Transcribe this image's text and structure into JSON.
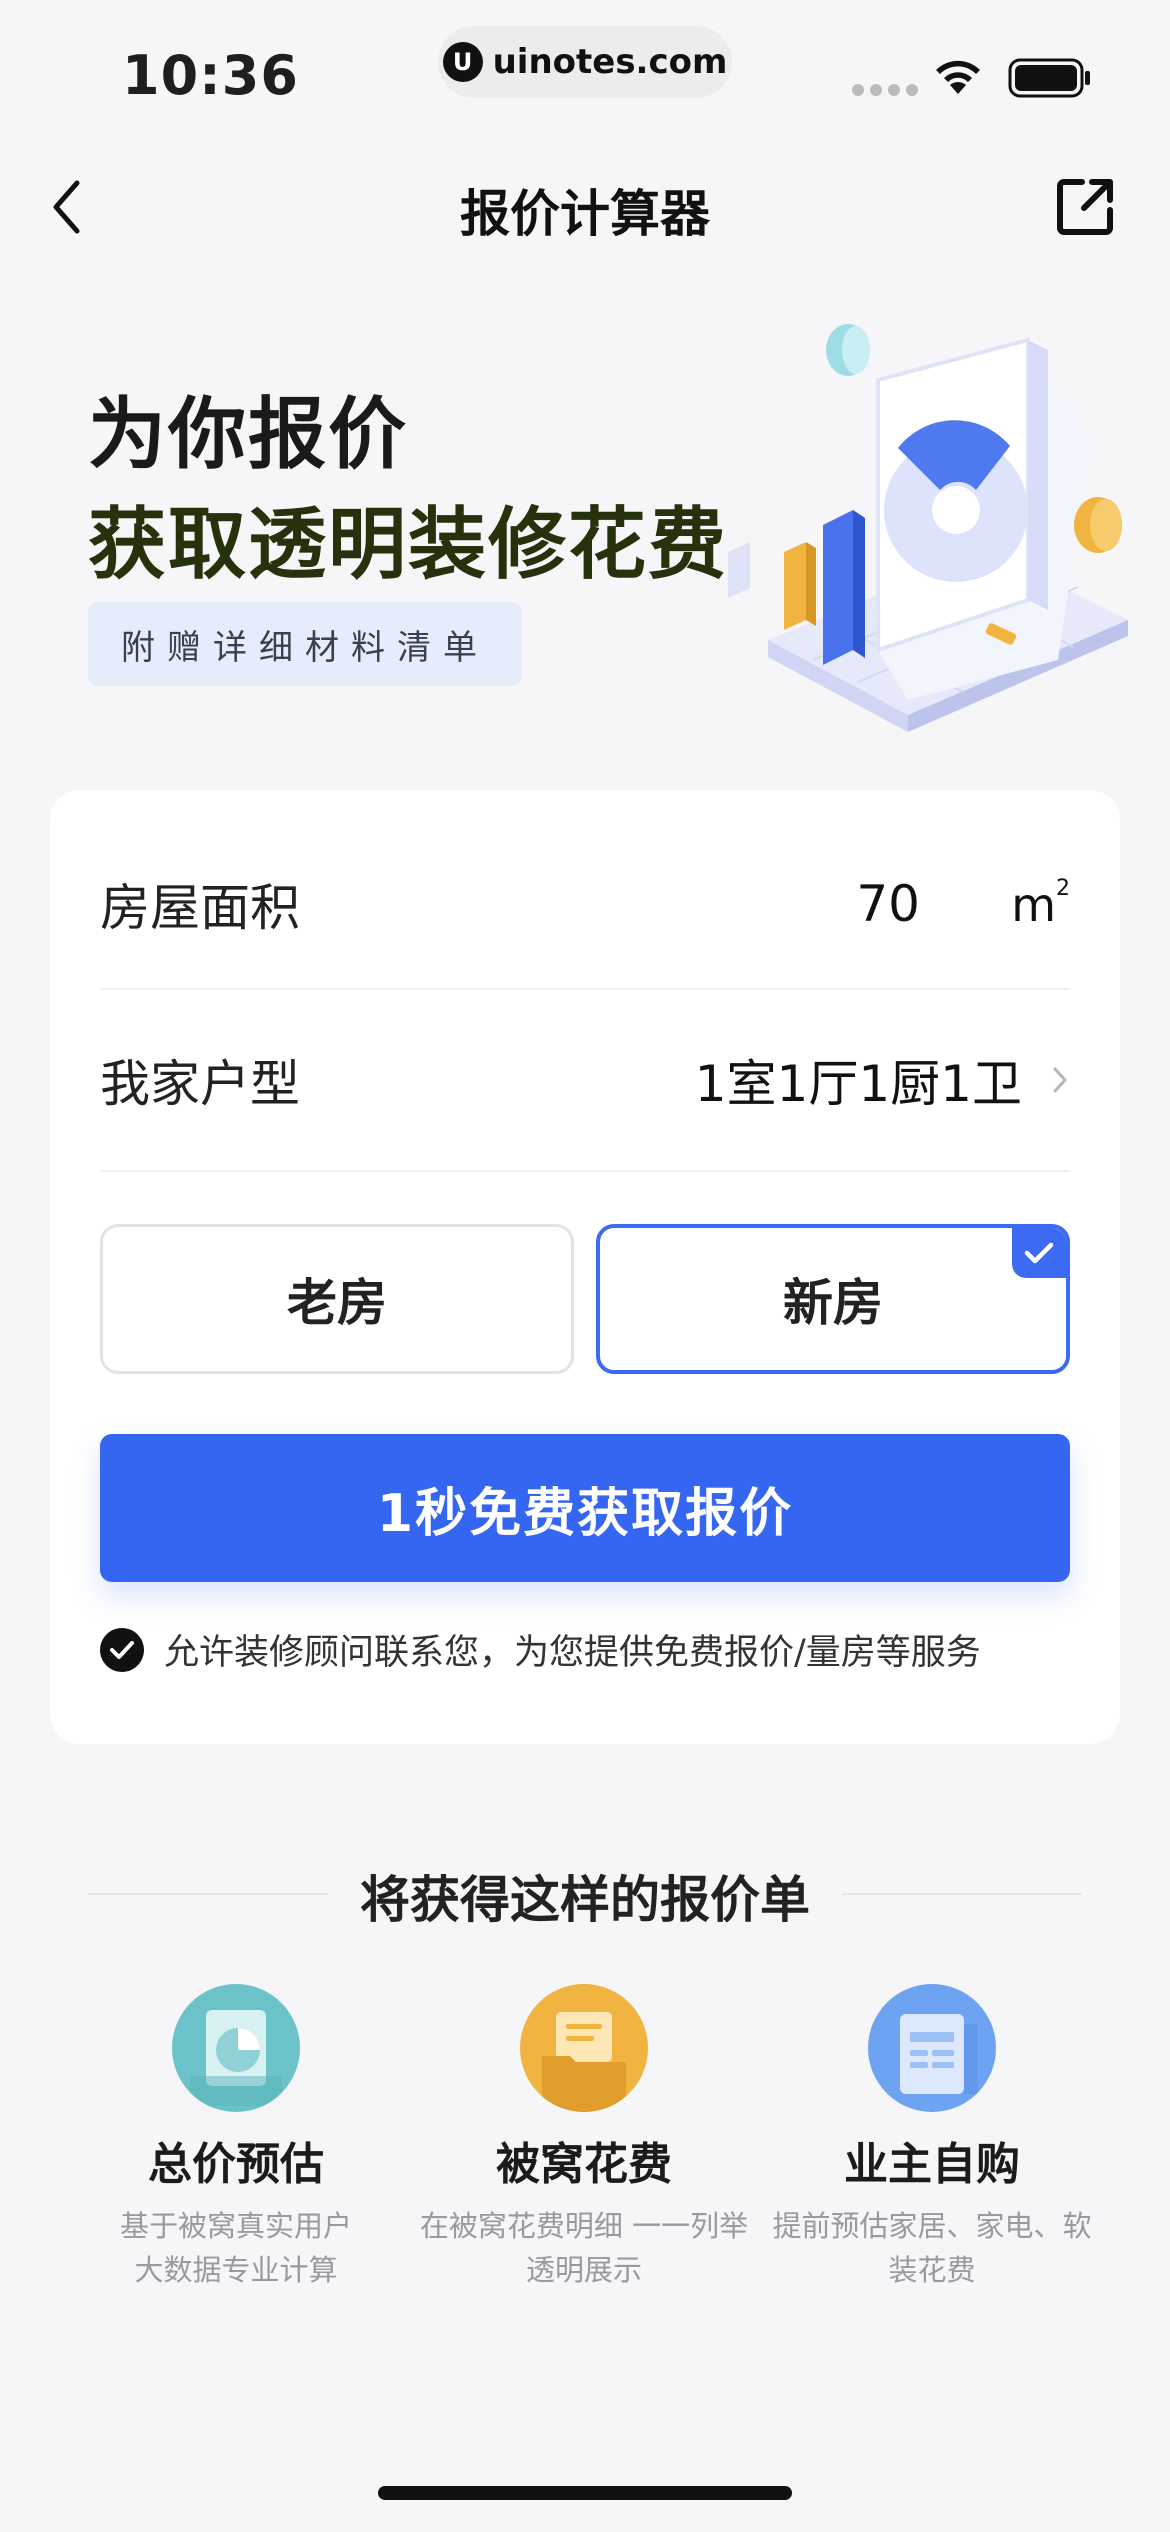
{
  "status_bar": {
    "time": "10:36",
    "url": "uinotes.com",
    "url_logo": "U"
  },
  "nav": {
    "title": "报价计算器",
    "back_icon": "chevron-left-icon",
    "share_icon": "share-external-icon"
  },
  "hero": {
    "title": "为你报价",
    "subtitle": "获取透明装修花费",
    "badge": "附赠详细材料清单"
  },
  "form": {
    "area_label": "房屋面积",
    "area_value": "70",
    "area_unit": "m",
    "area_unit_sup": "2",
    "layout_label": "我家户型",
    "layout_value": "1室1厅1厨1卫",
    "house_types": [
      {
        "label": "老房",
        "selected": false
      },
      {
        "label": "新房",
        "selected": true
      }
    ],
    "submit_label": "1秒免费获取报价",
    "consent_text": "允许装修顾问联系您，为您提供免费报价/量房等服务",
    "consent_checked": true
  },
  "quote_section": {
    "title": "将获得这样的报价单",
    "features": [
      {
        "title": "总价预估",
        "desc_line1": "基于被窝真实用户",
        "desc_line2": "大数据专业计算",
        "icon": "pie-chart-icon",
        "color": "#6cc2c9"
      },
      {
        "title": "被窝花费",
        "desc_line1": "在被窝花费明细 一一列举",
        "desc_line2": "透明展示",
        "icon": "folder-icon",
        "color": "#f2b441"
      },
      {
        "title": "业主自购",
        "desc_line1": "提前预估家居、家电、软",
        "desc_line2": "装花费",
        "icon": "document-list-icon",
        "color": "#6ea3f2"
      }
    ]
  },
  "colors": {
    "accent": "#3566f2",
    "background": "#f6f6f8"
  }
}
